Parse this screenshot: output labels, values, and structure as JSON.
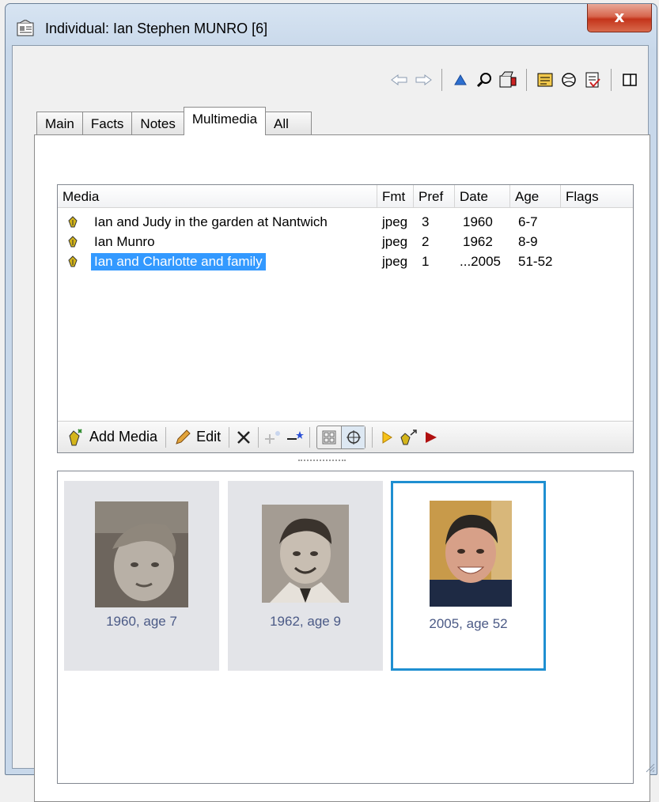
{
  "window": {
    "title": "Individual: Ian Stephen MUNRO [6]",
    "close_label": "x"
  },
  "toolbar": {
    "icons": [
      "back-arrow-icon",
      "forward-arrow-icon",
      "up-triangle-icon",
      "search-icon",
      "camera-icon",
      "card-icon",
      "globe-icon",
      "report-icon",
      "panel-icon"
    ]
  },
  "tabs": [
    {
      "label": "Main",
      "active": false
    },
    {
      "label": "Facts",
      "active": false
    },
    {
      "label": "Notes",
      "active": false
    },
    {
      "label": "Multimedia",
      "active": true
    },
    {
      "label": "All",
      "active": false
    }
  ],
  "media_list": {
    "columns": [
      "Media",
      "Fmt",
      "Pref",
      "Date",
      "Age",
      "Flags"
    ],
    "rows": [
      {
        "media": "Ian and Judy in the garden at Nantwich",
        "fmt": "jpeg",
        "pref": "3",
        "date": "1960",
        "age": "6-7",
        "flags": "",
        "selected": false
      },
      {
        "media": "Ian Munro",
        "fmt": "jpeg",
        "pref": "2",
        "date": "1962",
        "age": "8-9",
        "flags": "",
        "selected": false
      },
      {
        "media": "Ian and Charlotte and family",
        "fmt": "jpeg",
        "pref": "1",
        "date": "...2005",
        "age": "51-52",
        "flags": "",
        "selected": true
      }
    ],
    "toolbar": {
      "add_media_label": "Add Media",
      "edit_label": "Edit"
    }
  },
  "thumbnails": [
    {
      "caption": "1960, age 7",
      "selected": false
    },
    {
      "caption": "1962, age 9",
      "selected": false
    },
    {
      "caption": "2005, age 52",
      "selected": true
    }
  ],
  "colors": {
    "selection": "#3399ff",
    "thumb_selected_border": "#1f8fd1",
    "caption": "#4b5a86",
    "close_button": "#c4341b"
  }
}
